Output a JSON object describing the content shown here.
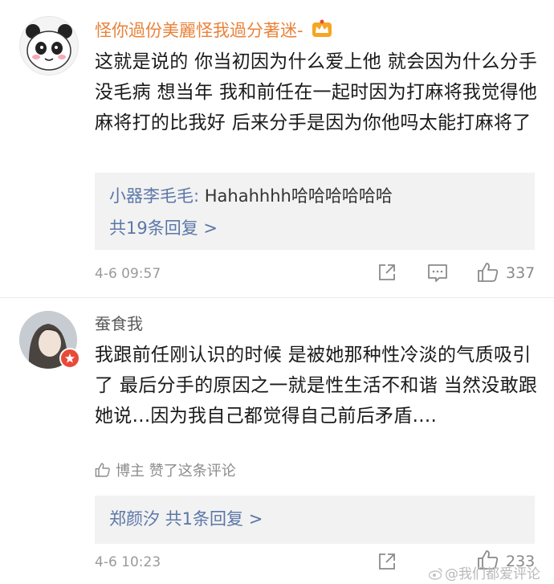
{
  "comments": [
    {
      "username": "怪你過份美麗怪我過分著迷-",
      "text": "这就是说的 你当初因为什么爱上他 就会因为什么分手 没毛病 想当年 我和前任在一起时因为打麻将我觉得他麻将打的比我好 后来分手是因为你他吗太能打麻将了",
      "reply_author": "小器李毛毛:",
      "reply_text": " Hahahhhh哈哈哈哈哈哈",
      "reply_more": "共19条回复 >",
      "timestamp": "4-6 09:57",
      "like_count": "337"
    },
    {
      "username": "蚕食我",
      "text": "我跟前任刚认识的时候  是被她那种性冷淡的气质吸引了   最后分手的原因之一就是性生活不和谐 当然没敢跟她说...因为我自己都觉得自己前后矛盾....",
      "liked_by": "博主 赞了这条评论",
      "reply_author": "郑颜汐",
      "reply_more": " 共1条回复 >",
      "timestamp": "4-6 10:23",
      "like_count": "233"
    }
  ],
  "watermark": "@我们都爱评论",
  "colors": {
    "username_orange": "#e8833a",
    "link_blue": "#5b77a8",
    "meta_gray": "#9a9a9a",
    "reply_bg": "#f2f2f2"
  }
}
